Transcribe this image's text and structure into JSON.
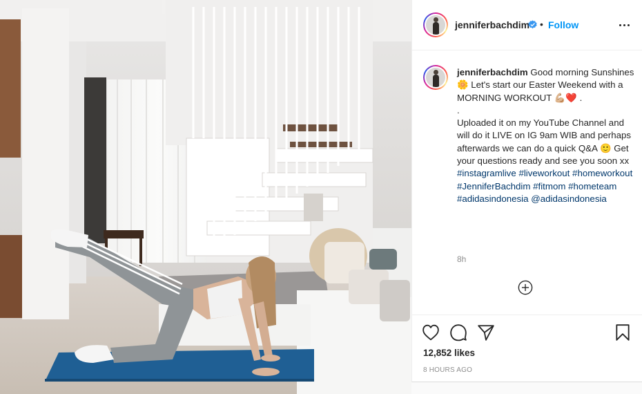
{
  "post": {
    "author": {
      "username": "jenniferbachdim",
      "verified": true
    },
    "follow_label": "Follow",
    "separator": "•",
    "caption": {
      "username": "jenniferbachdim",
      "line1": "Good morning Sunshines 🌼 Let's start our Easter Weekend with a MORNING WORKOUT 💪🏼❤️ .",
      "line2": ".",
      "line3": "Uploaded it on my YouTube Channel and will do it LIVE on IG 9am WIB and perhaps afterwards we can do a quick Q&A 🙂 Get your questions ready and see you soon xx ",
      "hashtags": [
        "#instagramlive",
        "#liveworkout",
        "#homeworkout",
        "#JenniferBachdim",
        "#fitmom",
        "#hometeam",
        "#adidasindonesia"
      ],
      "mention": "@adidasindonesia"
    },
    "caption_time": "8h",
    "likes": "12,852 likes",
    "time_ago": "8 HOURS AGO"
  },
  "icons": {
    "verified": "verified-badge-icon",
    "more": "more-options-icon",
    "like": "heart-icon",
    "comment": "comment-icon",
    "share": "paper-plane-icon",
    "save": "bookmark-icon",
    "load_more": "plus-circle-icon"
  },
  "colors": {
    "link_blue": "#0095f6",
    "hashtag": "#00376b",
    "muted": "#8e8e8e",
    "mat": "#1f5f94"
  }
}
